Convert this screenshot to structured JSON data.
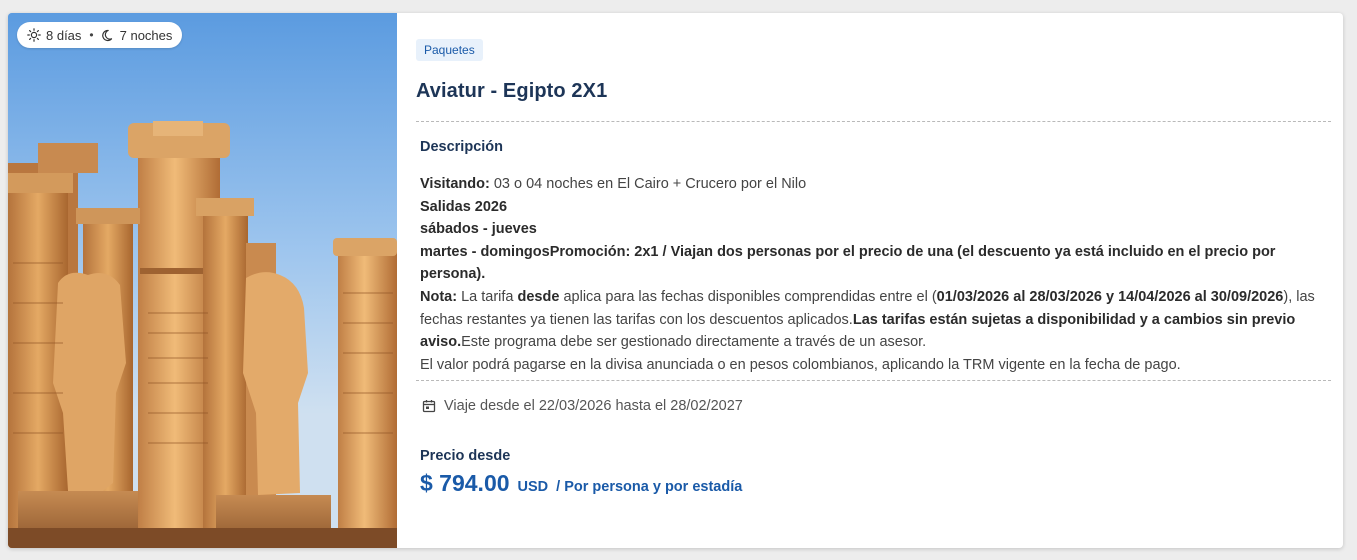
{
  "card": {
    "duration": {
      "days": "8 días",
      "nights": "7 noches",
      "separator": "•",
      "sun_icon": "sun-icon",
      "moon_icon": "moon-icon"
    },
    "category_tag": "Paquetes",
    "title": "Aviatur - Egipto 2X1",
    "description_label": "Descripción",
    "description": {
      "visiting_label": "Visitando:",
      "visiting_text": " 03 o 04 noches en El Cairo + Crucero por el Nilo",
      "departures_title": "Salidas 2026",
      "departures_days_1": "sábados - jueves",
      "departures_days_2": "martes - domingos",
      "promo_text": "Promoción: 2x1 / Viajan dos personas por el precio de una (el descuento ya está incluido en el precio por persona).",
      "note_label": "Nota:",
      "note_text_1": " La tarifa ",
      "note_bold_desde": "desde",
      "note_text_2": " aplica para las fechas disponibles comprendidas entre el (",
      "note_dates": "01/03/2026 al 28/03/2026 y 14/04/2026 al 30/09/2026",
      "note_text_3": "), las fechas restantes ya tienen las tarifas con los descuentos aplicados.",
      "note_availability": "Las tarifas están sujetas a disponibilidad y a cambios sin previo aviso.",
      "note_text_4": "Este programa debe ser gestionado directamente a través de un asesor.",
      "payment_text": "El valor podrá pagarse en la divisa anunciada o en pesos colombianos, aplicando la TRM vigente en la fecha de pago."
    },
    "travel_dates": "Viaje desde el 22/03/2026 hasta el 28/02/2027",
    "calendar_icon": "calendar-icon",
    "price": {
      "label": "Precio desde",
      "amount": "$ 794.00",
      "currency": "USD",
      "unit": "/ Por persona y por estadía"
    },
    "colors": {
      "accent_blue": "#1a5aa8",
      "title_navy": "#1d3557",
      "tag_bg": "#e8f1fb"
    }
  }
}
